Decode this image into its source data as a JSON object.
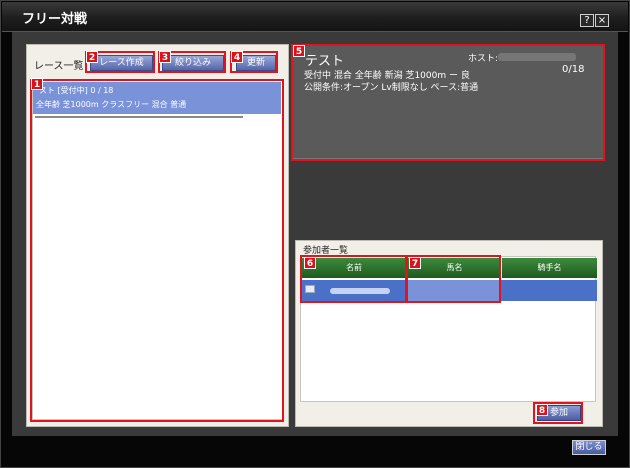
{
  "window": {
    "title": "フリー対戦",
    "help_label": "?",
    "close_label": "×"
  },
  "race_panel": {
    "title": "レース一覧",
    "buttons": {
      "create": "レース作成",
      "filter": "絞り込み",
      "refresh": "更新"
    },
    "selected_race": {
      "line1": "スト [受付中] 0 / 18",
      "line2": "全年齢 芝1000m クラスフリー 混合 普通"
    }
  },
  "race_detail": {
    "name": "テスト",
    "host_label": "ホスト:",
    "count": "0/18",
    "info_line1": "受付中 混合 全年齢 新潟 芝1000m ー 良",
    "info_line2": "公開条件:オープン Lv制限なし ペース:普通"
  },
  "participants": {
    "title": "参加者一覧",
    "columns": [
      "名前",
      "馬名",
      "騎手名"
    ],
    "row_icon": "ID"
  },
  "buttons": {
    "join": "参加",
    "close": "閉じる"
  },
  "annotations": [
    "1",
    "2",
    "3",
    "4",
    "5",
    "6",
    "7",
    "8"
  ],
  "colors": {
    "highlight": "#e0141e",
    "selection": "#4a70c8",
    "header_green": "#2e7a2e"
  }
}
